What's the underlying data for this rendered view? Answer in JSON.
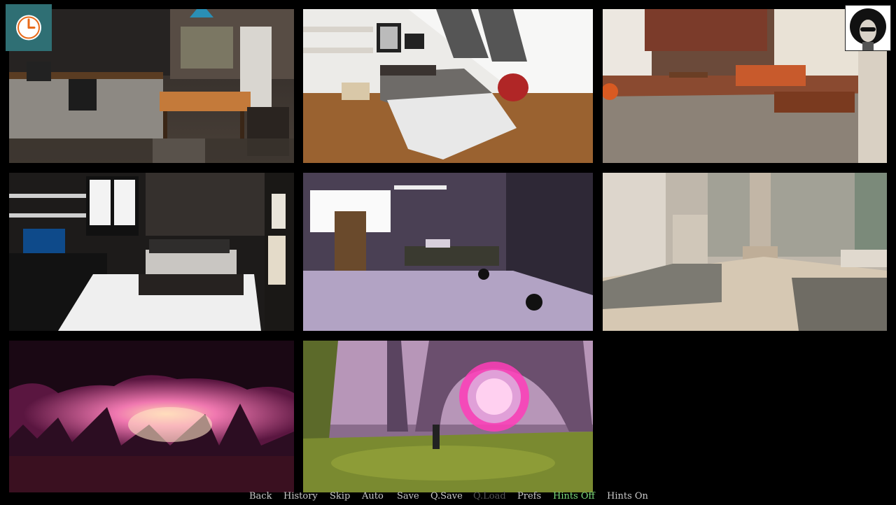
{
  "quick_menu": {
    "back": "Back",
    "history": "History",
    "skip": "Skip",
    "auto": "Auto",
    "save": "Save",
    "qsave": "Q.Save",
    "qload": "Q.Load",
    "prefs": "Prefs",
    "hints_off": "Hints Off",
    "hints_on": "Hints On"
  },
  "hud": {
    "clock_icon": "clock-icon",
    "portrait": "character-portrait"
  },
  "locations": [
    {
      "scene": "kitchen"
    },
    {
      "scene": "attic-bedroom"
    },
    {
      "scene": "lounge"
    },
    {
      "scene": "dark-bedroom"
    },
    {
      "scene": "purple-room"
    },
    {
      "scene": "bathhouse"
    },
    {
      "scene": "pink-cave"
    },
    {
      "scene": "portal-forest"
    }
  ],
  "colors": {
    "background": "#000000",
    "menu_text": "#c9c9c9",
    "menu_disabled": "#555555",
    "menu_active": "#7ddc7d",
    "clock_bg": "#2f6f74"
  }
}
